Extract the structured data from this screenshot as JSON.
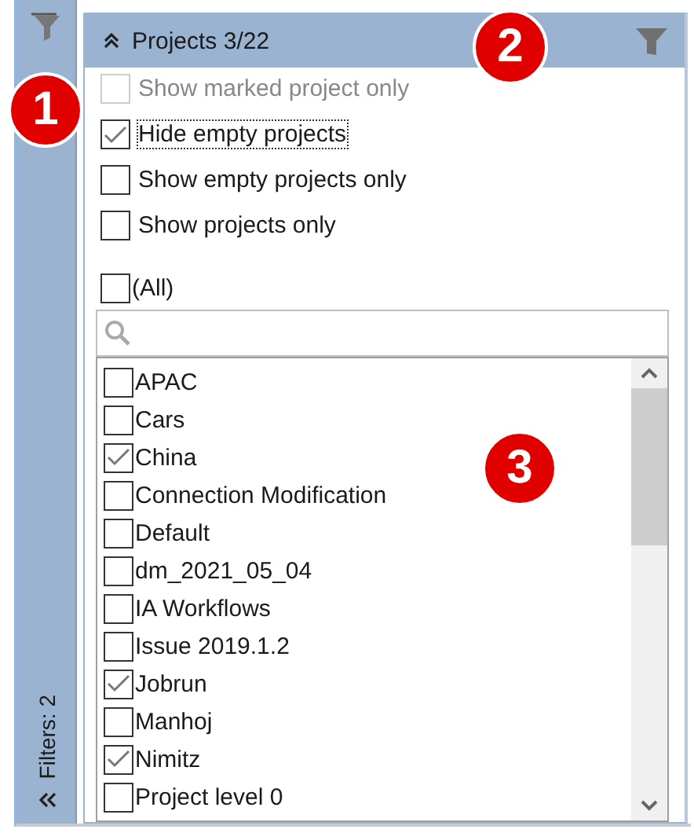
{
  "sidebar": {
    "label": "Filters: 2"
  },
  "panel": {
    "title": "Projects 3/22",
    "expanded": true
  },
  "options": [
    {
      "label": "Show marked project only",
      "checked": false,
      "disabled": true,
      "focused": false
    },
    {
      "label": "Hide empty projects",
      "checked": true,
      "disabled": false,
      "focused": true
    },
    {
      "label": "Show empty projects only",
      "checked": false,
      "disabled": false,
      "focused": false
    },
    {
      "label": "Show projects only",
      "checked": false,
      "disabled": false,
      "focused": false
    }
  ],
  "all": {
    "label": "(All)",
    "checked": false
  },
  "items": [
    {
      "label": "APAC",
      "checked": false
    },
    {
      "label": "Cars",
      "checked": false
    },
    {
      "label": "China",
      "checked": true
    },
    {
      "label": "Connection Modification",
      "checked": false
    },
    {
      "label": "Default",
      "checked": false
    },
    {
      "label": "dm_2021_05_04",
      "checked": false
    },
    {
      "label": "IA Workflows",
      "checked": false
    },
    {
      "label": "Issue 2019.1.2",
      "checked": false
    },
    {
      "label": "Jobrun",
      "checked": true
    },
    {
      "label": "Manhoj",
      "checked": false
    },
    {
      "label": "Nimitz",
      "checked": true
    },
    {
      "label": "Project level 0",
      "checked": false
    }
  ],
  "callouts": [
    {
      "label": "1"
    },
    {
      "label": "2"
    },
    {
      "label": "3"
    }
  ]
}
